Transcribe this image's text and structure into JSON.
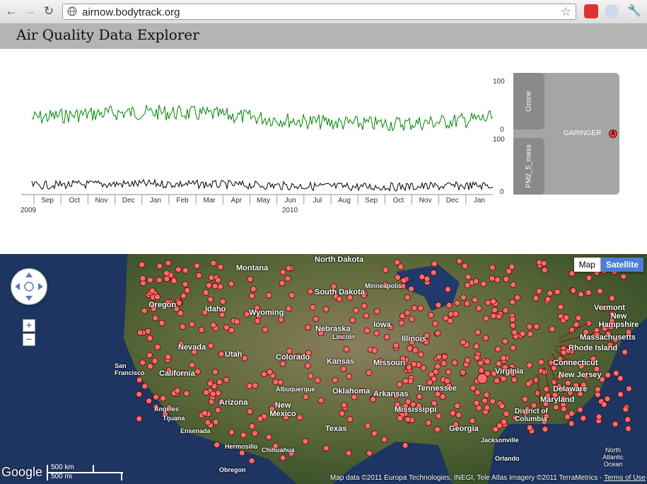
{
  "browser": {
    "url": "airnow.bodytrack.org",
    "back_icon": "back-arrow-icon",
    "forward_icon": "forward-arrow-icon",
    "reload_icon": "reload-icon"
  },
  "app": {
    "title": "Air Quality Data Explorer"
  },
  "grapher": {
    "channels": [
      {
        "name": "Ozone",
        "y_max": "100",
        "y_min": "0",
        "color": "#008800"
      },
      {
        "name": "PM2_5_mass",
        "y_max": "100",
        "y_min": "0",
        "color": "#000000"
      }
    ],
    "station": "GARINGER",
    "station_marker": "A",
    "months": [
      "Sep",
      "Oct",
      "Nov",
      "Dec",
      "Jan",
      "Feb",
      "Mar",
      "Apr",
      "May",
      "Jun",
      "Jul",
      "Aug",
      "Sep",
      "Oct",
      "Nov",
      "Dec",
      "Jan"
    ],
    "years": [
      {
        "label": "2009"
      },
      {
        "label": "2010"
      }
    ]
  },
  "map": {
    "type_buttons": {
      "map": "Map",
      "satellite": "Satellite"
    },
    "selected_type": "Satellite",
    "zoom_in": "+",
    "zoom_out": "−",
    "scale_km": "500 km",
    "scale_mi": "500 mi",
    "logo": "Google",
    "attribution": "Map data ©2011 Europa Technologies, INEGI, Tele Atlas Imagery ©2011 TerraMetrics - ",
    "terms": "Terms of Use",
    "marker_color": "#ff6b6b",
    "labels": {
      "montana": "Montana",
      "north_dakota": "North Dakota",
      "south_dakota": "South Dakota",
      "oregon": "Oregon",
      "idaho": "Idaho",
      "wyoming": "Wyoming",
      "nebraska": "Nebraska",
      "nevada": "Nevada",
      "utah": "Utah",
      "colorado": "Colorado",
      "kansas": "Kansas",
      "missouri": "Missouri",
      "illinois": "Illinois",
      "iowa": "Iowa",
      "california": "California",
      "arizona": "Arizona",
      "new_mexico": "New Mexico",
      "oklahoma": "Oklahoma",
      "arkansas": "Arkansas",
      "texas": "Texas",
      "mississippi": "Mississippi",
      "georgia": "Georgia",
      "virginia": "Virginia",
      "tennessee": "Tennessee",
      "vermont": "Vermont",
      "new_hampshire": "New Hampshire",
      "massachusetts": "Massachusetts",
      "rhode_island": "Rhode Island",
      "connecticut": "Connecticut",
      "new_jersey": "New Jersey",
      "delaware": "Delaware",
      "maryland": "Maryland",
      "dc": "District of Columbia",
      "san_francisco": "San Francisco",
      "albuquerque": "Albuquerque",
      "tijuana": "Tijuana",
      "ensenada": "Ensenada",
      "hermosillo": "Hermosillo",
      "chihuahua": "Chihuahua",
      "obregon": "Obregon",
      "minneapolis": "Minneapolis",
      "lincoln": "Lincoln",
      "jacksonville": "Jacksonville",
      "orlando": "Orlando",
      "angeles": "Angeles",
      "north_atlantic": "North Atlantic Ocean"
    },
    "selected_marker": "A"
  }
}
